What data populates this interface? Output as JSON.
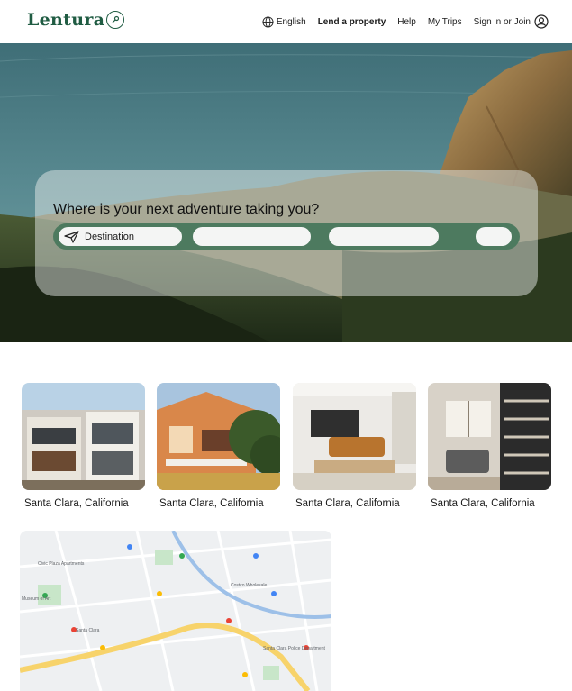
{
  "brand": {
    "name": "Lentura"
  },
  "nav": {
    "language": "English",
    "lend": "Lend a property",
    "help": "Help",
    "trips": "My Trips",
    "signin": "Sign in or Join"
  },
  "search": {
    "title": "Where is your next adventure taking you?",
    "destination_label": "Destination"
  },
  "listings": [
    {
      "label": "Santa Clara, California"
    },
    {
      "label": "Santa Clara, California"
    },
    {
      "label": "Santa Clara, California"
    },
    {
      "label": "Santa Clara, California"
    }
  ],
  "colors": {
    "brand_green": "#205c43",
    "search_bar": "#4d7a5f"
  },
  "map": {
    "labels": [
      "Santa Clara",
      "Costco Wholesale",
      "Santa Clara Police Department",
      "Museum of Art",
      "Civic Plaza Apartments"
    ]
  }
}
